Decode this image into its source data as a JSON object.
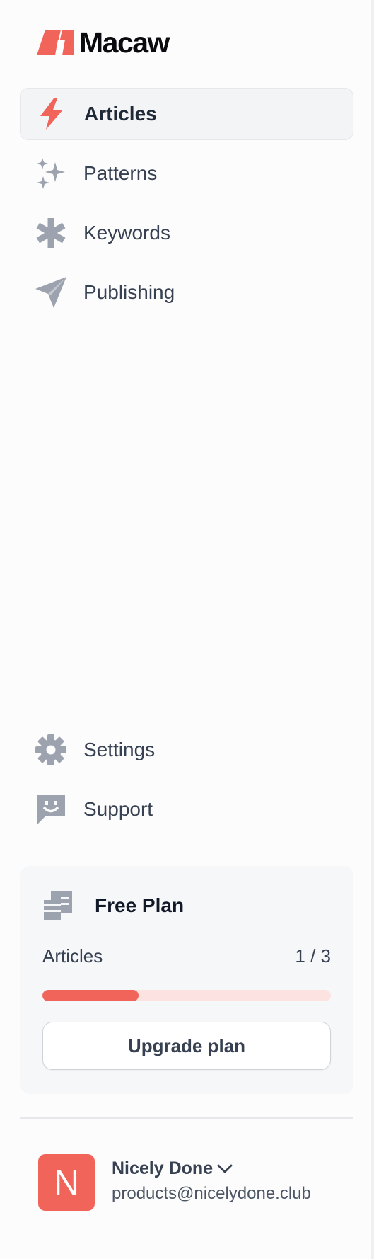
{
  "brand": {
    "name": "Macaw",
    "accent": "#f0645a",
    "logo_icon": "macaw-logo-icon"
  },
  "nav": {
    "items": [
      {
        "label": "Articles",
        "icon": "lightning-bolt-icon",
        "active": true
      },
      {
        "label": "Patterns",
        "icon": "sparkles-icon",
        "active": false
      },
      {
        "label": "Keywords",
        "icon": "asterisk-icon",
        "active": false
      },
      {
        "label": "Publishing",
        "icon": "paper-plane-icon",
        "active": false
      }
    ],
    "bottom_items": [
      {
        "label": "Settings",
        "icon": "gear-icon"
      },
      {
        "label": "Support",
        "icon": "smiley-chat-icon"
      }
    ]
  },
  "plan": {
    "icon": "receipt-icon",
    "title": "Free Plan",
    "usage_label": "Articles",
    "usage_count": "1 / 3",
    "usage_fraction": 0.333,
    "upgrade_label": "Upgrade plan"
  },
  "user": {
    "initial": "N",
    "name": "Nicely Done",
    "email": "products@nicelydone.club",
    "menu_icon": "chevron-down-icon"
  }
}
